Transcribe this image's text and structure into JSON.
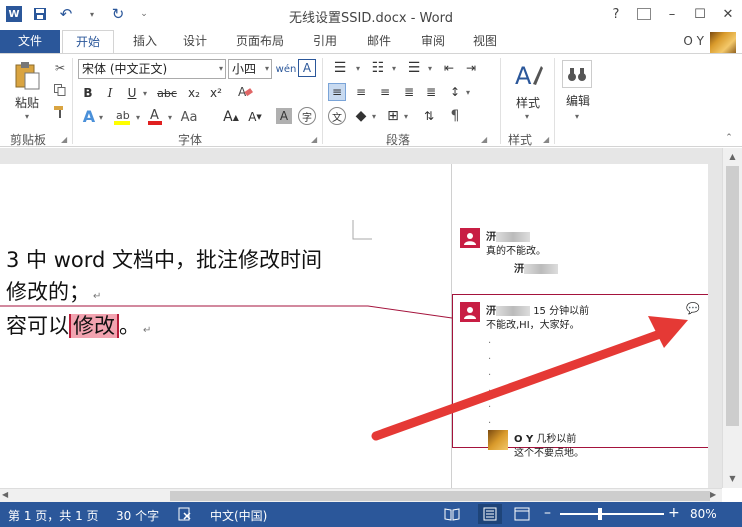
{
  "window": {
    "title": "无线设置SSID.docx - Word",
    "controls": [
      "?",
      "–",
      "☐",
      "✕"
    ]
  },
  "tabs": [
    "文件",
    "开始",
    "插入",
    "设计",
    "页面布局",
    "引用",
    "邮件",
    "审阅",
    "视图"
  ],
  "user": "O Y",
  "ribbon": {
    "clipboard": {
      "label": "剪贴板",
      "paste": "粘贴"
    },
    "font": {
      "label": "字体",
      "font_name": "宋体 (中文正文)",
      "font_size": "小四"
    },
    "paragraph": {
      "label": "段落"
    },
    "styles": {
      "label": "样式",
      "button": "样式"
    },
    "editing": {
      "button": "编辑"
    }
  },
  "document": {
    "line1": "3 中 word 文档中，批注修改时间",
    "line2": "修改的；",
    "line3_before": "容可以",
    "line3_highlight": "修改",
    "line3_after": "。"
  },
  "comments": [
    {
      "author": "汧",
      "time": "",
      "text": "真的不能改。"
    },
    {
      "author": "汧",
      "time": "",
      "text": ""
    },
    {
      "author": "汧",
      "time": "15 分钟以前",
      "text": "不能改,HI，大家好。"
    },
    {
      "author": "O Y",
      "time": "几秒以前",
      "text": "这个不要点地。"
    }
  ],
  "statusbar": {
    "page": "第 1 页，共 1 页",
    "words": "30 个字",
    "lang": "中文(中国)",
    "zoom": "80%"
  },
  "colors": {
    "accent": "#2b579a",
    "comment_line": "#a4133c",
    "arrow": "#e53935"
  }
}
